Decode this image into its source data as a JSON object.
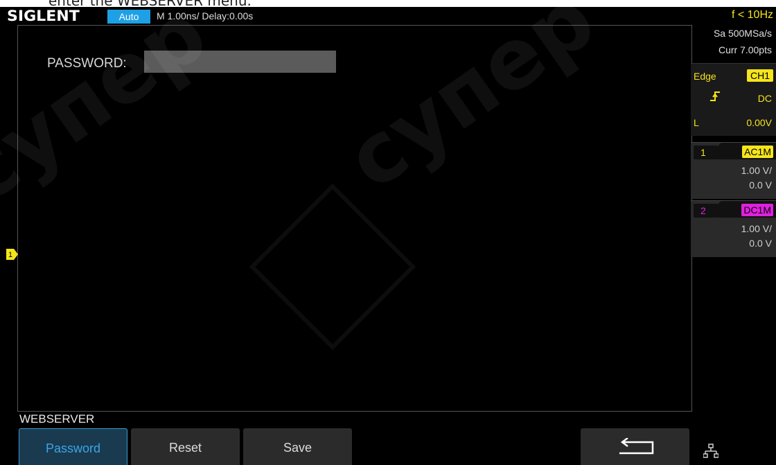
{
  "doc_caption": "enter the WEBSERVER menu.",
  "topbar": {
    "brand": "SIGLENT",
    "trigger_mode": "Auto",
    "timebase": "M 1.00ns/  Delay:0.00s",
    "frequency": "f < 10Hz"
  },
  "acquisition": {
    "sample_rate": "Sa 500MSa/s",
    "curr_points": "Curr 7.00pts"
  },
  "trigger": {
    "type": "Edge",
    "source": "CH1",
    "slope_icon": "rising-edge-icon",
    "coupling": "DC",
    "level_label": "L",
    "level": "0.00V"
  },
  "channels": [
    {
      "number": "1",
      "coupling": "AC1M",
      "scale": "1.00 V/",
      "offset": "0.0 V",
      "color": "#f5e51b"
    },
    {
      "number": "2",
      "coupling": "DC1M",
      "scale": "1.00 V/",
      "offset": "0.0 V",
      "color": "#e020e0"
    }
  ],
  "display": {
    "password_label": "PASSWORD:",
    "password_value": "",
    "ch1_marker": "1"
  },
  "menu": {
    "title": "WEBSERVER",
    "keys": [
      "Password",
      "Reset",
      "Save"
    ],
    "back_icon": "return-arrow-icon",
    "lan_icon": "network-icon"
  },
  "watermark": "супер"
}
